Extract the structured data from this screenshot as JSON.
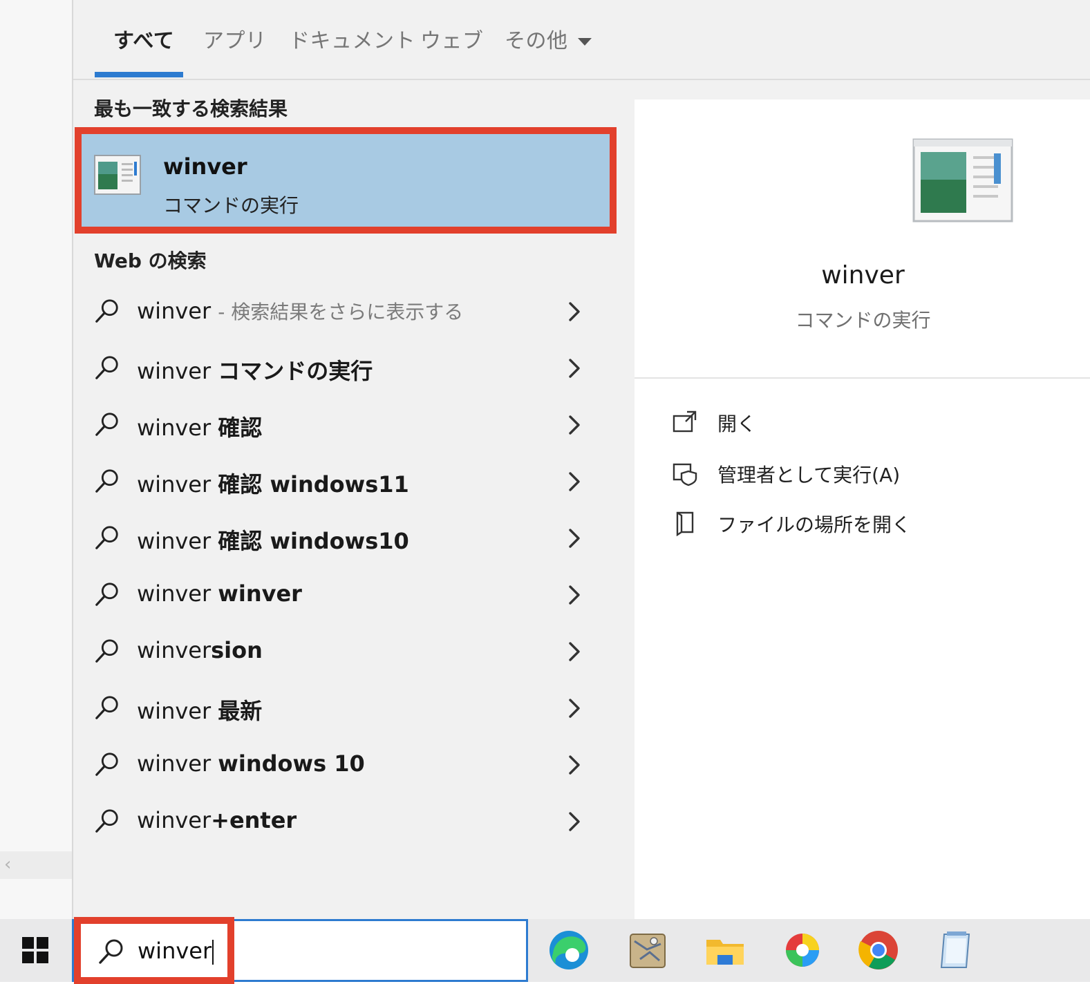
{
  "tabs": [
    {
      "label": "すべて"
    },
    {
      "label": "アプリ"
    },
    {
      "label": "ドキュメント"
    },
    {
      "label": "ウェブ"
    },
    {
      "label": "その他"
    }
  ],
  "best_match": {
    "section_title": "最も一致する検索結果",
    "name": "winver",
    "subtitle": "コマンドの実行"
  },
  "web_search": {
    "section_title": "Web の検索",
    "rows": [
      {
        "prefix": "winver",
        "suffix": "",
        "muted": "- 検索結果をさらに表示する"
      },
      {
        "prefix": "winver",
        "suffix": "コマンドの実行",
        "muted": ""
      },
      {
        "prefix": "winver",
        "suffix": "確認",
        "muted": ""
      },
      {
        "prefix": "winver",
        "suffix": "確認 windows11",
        "muted": ""
      },
      {
        "prefix": "winver",
        "suffix": "確認 windows10",
        "muted": ""
      },
      {
        "prefix": "winver",
        "suffix": "winver",
        "muted": ""
      },
      {
        "prefix": "winver",
        "suffix": "sion",
        "muted": ""
      },
      {
        "prefix": "winver",
        "suffix": "最新",
        "muted": ""
      },
      {
        "prefix": "winver",
        "suffix": "windows 10",
        "muted": ""
      },
      {
        "prefix": "winver",
        "suffix": "+enter",
        "muted": ""
      }
    ]
  },
  "preview": {
    "name": "winver",
    "subtitle": "コマンドの実行",
    "actions": [
      {
        "label": "開く",
        "icon": "open-icon"
      },
      {
        "label": "管理者として実行(A)",
        "icon": "run-as-admin-icon"
      },
      {
        "label": "ファイルの場所を開く",
        "icon": "file-location-icon"
      }
    ]
  },
  "taskbar": {
    "search_value": "winver",
    "apps": [
      "edge-icon",
      "maps-icon",
      "file-explorer-icon",
      "color-wheel-icon",
      "chrome-icon",
      "notepad-icon"
    ]
  },
  "colors": {
    "accent": "#2d7bd0",
    "highlight_box": "#e2402c",
    "selected_row": "#a8cae3",
    "panel_bg": "#f1f1f1"
  }
}
